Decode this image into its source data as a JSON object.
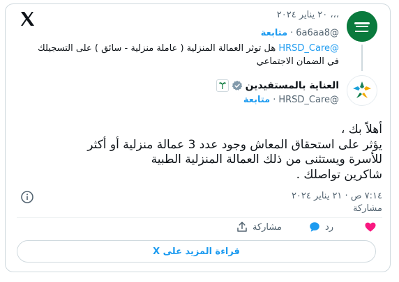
{
  "reply_context": {
    "time_text": "،،، ٢٠ يناير ٢٠٢٤",
    "handle": "@6a6aa8",
    "separator": "·",
    "follow_label": "متابعة",
    "mention": "@HRSD_Care",
    "text": "هل توثر العمالة المنزلية ( عاملة منزلية - سائق ) على التسجيلك في الضمان الاجتماعي"
  },
  "tweet": {
    "display_name": "العناية بالمستفيدين",
    "handle": "@HRSD_Care",
    "separator": "·",
    "follow_label": "متابعة",
    "body_lines": [
      "أهلاً بك ،",
      "يؤثر على استحقاق المعاش وجود عدد 3 عمالة منزلية أو أكثر",
      "للأسرة ويستثنى من ذلك العمالة المنزلية الطبية",
      "شاكرين تواصلك ."
    ],
    "timestamp": "٧:١٤ ص · ٢١ يناير ٢٠٢٤",
    "share_label": "مشاركة"
  },
  "actions": {
    "like_label": "",
    "reply_label": "رد",
    "share_label": "مشاركة"
  },
  "more_button": {
    "label": "قراءة المزيد على X"
  },
  "colors": {
    "accent": "#1d9bf0",
    "like": "#f91880",
    "muted": "#536471",
    "border": "#cfd9de",
    "saudi_green": "#0a7a3d"
  },
  "icons": {
    "brand": "x-logo-icon",
    "info": "info-icon",
    "like": "heart-icon",
    "reply": "reply-bubble-icon",
    "share": "share-upload-icon",
    "verified": "verified-badge-icon"
  }
}
